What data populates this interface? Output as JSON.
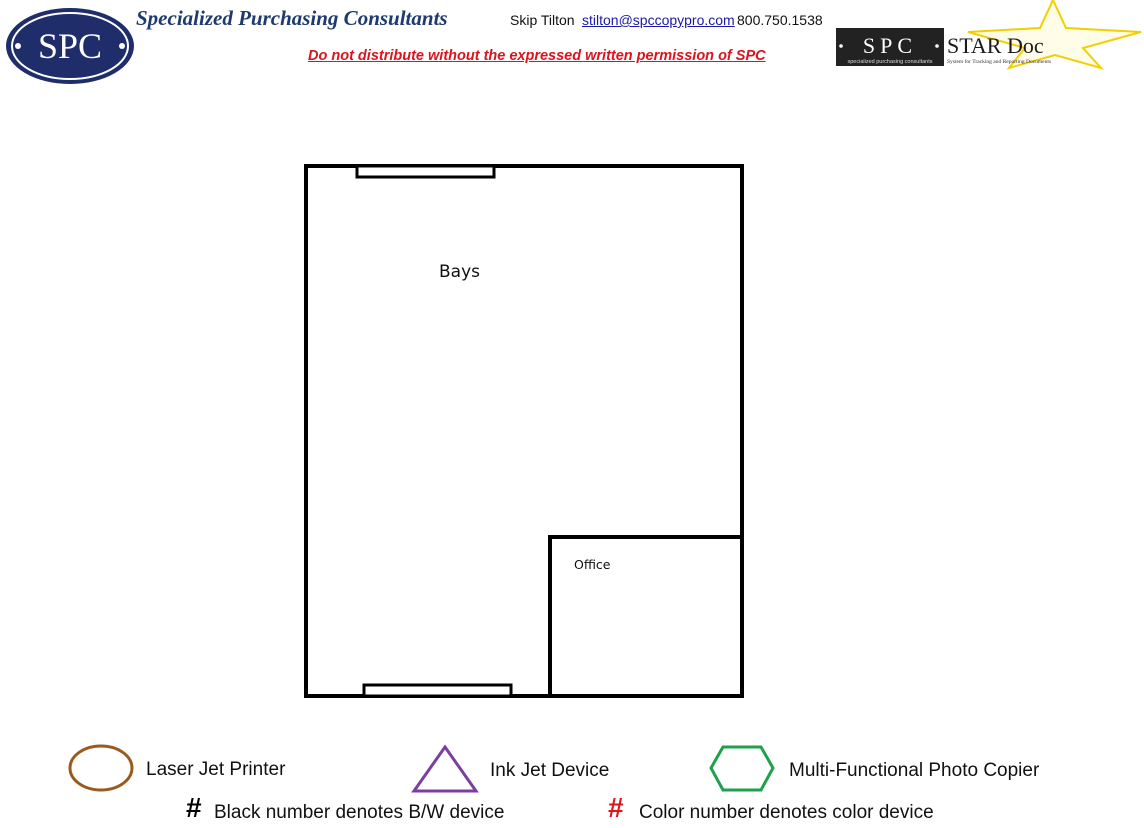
{
  "header": {
    "logo_left_text": "SPC",
    "company_name": "Specialized Purchasing Consultants",
    "contact_name": "Skip Tilton",
    "contact_email": "stilton@spccopypro.com",
    "contact_phone": "800.750.1538",
    "disclaimer": "Do not distribute without the expressed written permission of SPC",
    "star_logo": {
      "spc_text": "SPC",
      "spc_subtitle": "specialized purchasing consultants",
      "product_name": "STAR Doc",
      "product_subtitle": "System for Tracking and Reporting Documents"
    }
  },
  "floorplan": {
    "rooms": {
      "bays": "Bays",
      "office": "Office"
    }
  },
  "legend": {
    "laser_jet": "Laser Jet Printer",
    "ink_jet": "Ink Jet Device",
    "mfp": "Multi-Functional Photo Copier",
    "hash_symbol": "#",
    "bw_note": "Black number denotes B/W device",
    "color_note": "Color number denotes color device"
  },
  "colors": {
    "laser_jet": "#9a5a1e",
    "ink_jet": "#7b3fa0",
    "mfp": "#1ea14a",
    "disclaimer": "#d9141e",
    "brand_navy": "#1f2d6b",
    "color_hash": "#e0141b"
  },
  "icons": {
    "laser_jet": "ellipse-icon",
    "ink_jet": "triangle-icon",
    "mfp": "hexagon-icon"
  }
}
